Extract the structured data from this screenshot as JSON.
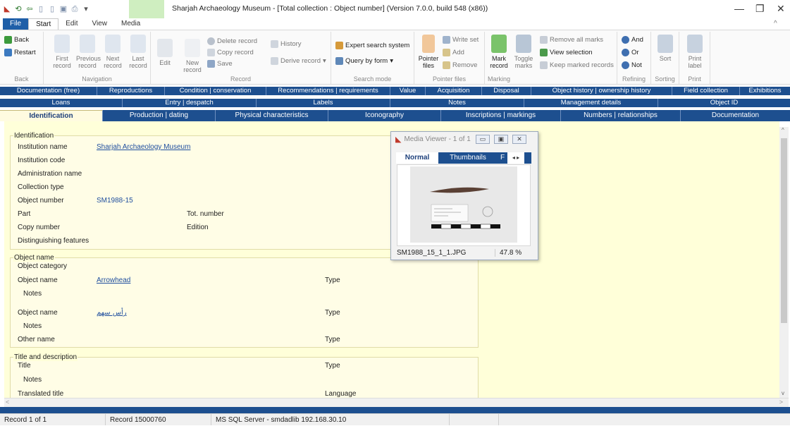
{
  "window": {
    "title": "Sharjah Archaeology Museum - [Total collection : Object number] (Version 7.0.0, build 548 (x86))",
    "minimize": "—",
    "restore": "❐",
    "close": "✕",
    "collapse": "^"
  },
  "ribbon_tabs": [
    "File",
    "Start",
    "Edit",
    "View",
    "Media"
  ],
  "ribbon": {
    "back": {
      "items": [
        "Back",
        "Restart"
      ],
      "label": "Back"
    },
    "navigation": {
      "buttons": [
        "First record",
        "Previous record",
        "Next record",
        "Last record"
      ],
      "label": "Navigation"
    },
    "record": {
      "edit": "Edit",
      "new": "New record",
      "delete": "Delete record",
      "copy": "Copy record",
      "save": "Save",
      "history": "History",
      "derive": "Derive record",
      "label": "Record"
    },
    "search": {
      "expert": "Expert search system",
      "query": "Query by form",
      "label": "Search mode"
    },
    "pointer": {
      "pointer": "Pointer files",
      "write": "Write set",
      "add": "Add",
      "remove": "Remove",
      "label": "Pointer files"
    },
    "marking": {
      "mark": "Mark record",
      "toggle": "Toggle marks",
      "remove_all": "Remove all marks",
      "view_sel": "View selection",
      "keep": "Keep marked records",
      "label": "Marking"
    },
    "refining": {
      "and": "And",
      "or": "Or",
      "not": "Not",
      "label": "Refining"
    },
    "sorting": {
      "sort": "Sort",
      "label": "Sorting"
    },
    "print": {
      "print": "Print label",
      "label": "Print"
    }
  },
  "tab_row1": [
    "Documentation (free)",
    "Reproductions",
    "Condition | conservation",
    "Recommendations | requirements",
    "Value",
    "Acquisition",
    "Disposal",
    "Object history | ownership history",
    "Field collection",
    "Exhibitions"
  ],
  "tab_row2": [
    "Loans",
    "Entry | despatch",
    "Labels",
    "Notes",
    "Management details",
    "Object ID"
  ],
  "tab_row3": [
    "Identification",
    "Production | dating",
    "Physical characteristics",
    "Iconography",
    "Inscriptions | markings",
    "Numbers | relationships",
    "Documentation"
  ],
  "identification": {
    "section": "Identification",
    "institution_name_label": "Institution name",
    "institution_name": "Sharjah Archaeology Museum",
    "institution_code_label": "Institution code",
    "administration_name_label": "Administration name",
    "collection_type_label": "Collection type",
    "object_number_label": "Object number",
    "object_number": "SM1988-15",
    "part_label": "Part",
    "tot_number_label": "Tot. number",
    "copy_number_label": "Copy number",
    "edition_label": "Edition",
    "distinguishing_label": "Distinguishing features"
  },
  "object_name": {
    "section": "Object name",
    "category_label": "Object category",
    "name_label": "Object name",
    "name1": "Arrowhead",
    "type_label": "Type",
    "notes_label": "Notes",
    "name2": "رأس سهم",
    "other_name_label": "Other name"
  },
  "title_desc": {
    "section": "Title and description",
    "title_label": "Title",
    "type_label": "Type",
    "notes_label": "Notes",
    "translated_label": "Translated title",
    "language_label": "Language"
  },
  "media_viewer": {
    "title": "Media Viewer - 1 of 1",
    "tabs": [
      "Normal",
      "Thumbnails",
      "F"
    ],
    "filename": "SM1988_15_1_1.JPG",
    "zoom": "47.8 %"
  },
  "status": {
    "record": "Record 1 of 1",
    "record_id": "Record 15000760",
    "server": "MS SQL Server - smdadlib 192.168.30.10"
  }
}
